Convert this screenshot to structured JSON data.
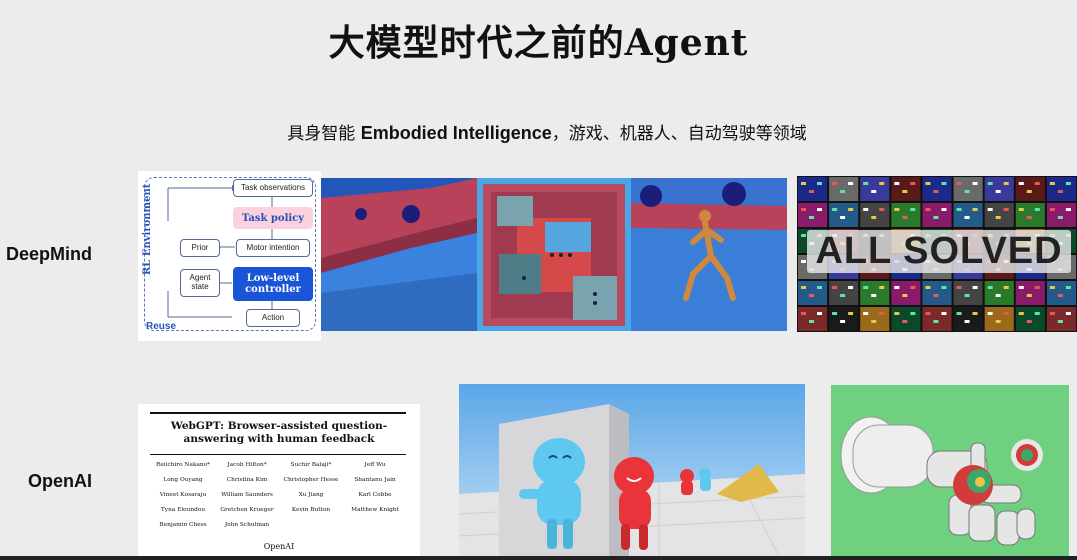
{
  "title": "大模型时代之前的Agent",
  "subtitle": {
    "prefix": "具身智能 ",
    "emphasis": "Embodied Intelligence",
    "suffix": "，游戏、机器人、自动驾驶等领域"
  },
  "rows": {
    "deepmind": {
      "label": "DeepMind"
    },
    "openai": {
      "label": "OpenAI"
    }
  },
  "rl_diagram": {
    "environment": "RL Environment",
    "reuse": "Reuse",
    "task_observations": "Task observations",
    "task_policy": "Task policy",
    "prior": "Prior",
    "motor_intention": "Motor intention",
    "agent_state": "Agent\nstate",
    "low_level_controller": "Low-level\ncontroller",
    "action": "Action"
  },
  "atari": {
    "overlay": "ALL SOLVED"
  },
  "webgpt": {
    "title": "WebGPT: Browser-assisted question-answering with human feedback",
    "authors": [
      "Reiichiro Nakano*",
      "Jacob Hilton*",
      "Suchir Balaji*",
      "Jeff Wu",
      "Long Ouyang",
      "Christina Kim",
      "Christopher Hesse",
      "Shantanu Jain",
      "Vineet Kosaraju",
      "William Saunders",
      "Xu Jiang",
      "Karl Cobbe",
      "Tyna Eloundou",
      "Gretchen Krueger",
      "Kevin Button",
      "Matthew Knight",
      "Benjamin Chess",
      "John Schulman"
    ],
    "org": "OpenAI"
  },
  "colors": {
    "background": "#ececec",
    "accent_blue": "#1a55d8",
    "pink": "#fbd1de",
    "hide_seek_floor": "#e8e8ea",
    "robot_bg": "#6fd07f"
  }
}
